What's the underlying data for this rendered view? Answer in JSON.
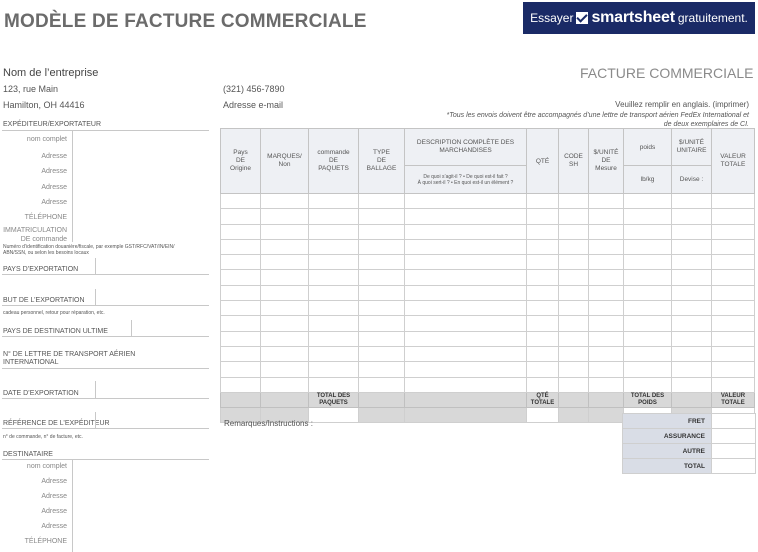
{
  "header": {
    "title": "MODÈLE DE FACTURE COMMERCIALE",
    "banner_try": "Essayer",
    "banner_brand": "smartsheet",
    "banner_free": "gratuitement."
  },
  "company": {
    "name": "Nom de l’entreprise",
    "address": "123, rue Main",
    "city": "Hamilton, OH 44416",
    "phone": "(321) 456-7890",
    "email": "Adresse e-mail"
  },
  "invoice_title": "FACTURE COMMERCIALE",
  "fill_note": "Veuillez remplir en anglais. (imprimer)",
  "notice_line1": "*Tous les envois doivent être accompagnés d’une lettre de transport aérien FedEx International et",
  "notice_line2": "de deux exemplaires de CI.",
  "exporter": {
    "section": "EXPÉDITEUR/EXPORTATEUR",
    "fields": [
      "nom complet",
      "Adresse",
      "Adresse",
      "Adresse",
      "Adresse",
      "TÉLÉPHONE"
    ],
    "reg_line1": "IMMATRICULATION",
    "reg_line2": "DE commande",
    "id_note_line1": "Numéro d’identification douanière/fiscale, par exemple GST/RFC/VAT/IN/EIN/",
    "id_note_line2": "ABN/SSN, ou selon les besoins locaux"
  },
  "fields": {
    "export_country": "PAYS D’EXPORTATION",
    "export_purpose": "BUT DE L’EXPORTATION",
    "export_purpose_note": "cadeau personnel, retour pour réparation, etc.",
    "destination_country": "PAYS DE DESTINATION ULTIME",
    "airway_line1": "N° DE LETTRE DE TRANSPORT AÉRIEN",
    "airway_line2": "INTERNATIONAL",
    "export_date": "DATE D’EXPORTATION",
    "shipper_ref": "RÉFÉRENCE DE L’EXPÉDITEUR",
    "shipper_ref_note": "n° de commande, n° de facture, etc."
  },
  "recipient": {
    "section": "DESTINATAIRE",
    "fields": [
      "nom complet",
      "Adresse",
      "Adresse",
      "Adresse",
      "Adresse",
      "TÉLÉPHONE"
    ]
  },
  "table": {
    "h_origin": "Pays\nDE\nOrigine",
    "h_marks": "MARQUES/\nNon",
    "h_packages": "commande\nDE\nPAQUETS",
    "h_packing": "TYPE\nDE\nBALLAGE",
    "h_desc": "DESCRIPTION COMPLÈTE DES\nMARCHANDISES",
    "h_desc_sub": "De quoi s’agit-il ? • De quoi est-il fait ?\nÀ quoi sert-il ? • En quoi est-il un élément ?",
    "h_qty": "QTÉ",
    "h_hs": "CODE\nSH",
    "h_measure": "$/UNITÉ\nDE\nMesure",
    "h_weight": "poids",
    "h_weight_unit": "lb/kg",
    "h_unit": "$/UNITÉ\nUNITAIRE",
    "h_unit_cur": "Devise :",
    "h_total": "VALEUR\nTOTALE",
    "tot_packages": "TOTAL DES\nPAQUETS",
    "tot_qty": "QTÉ\nTOTALE",
    "tot_weight": "TOTAL DES\nPOIDS",
    "tot_value": "VALEUR\nTOTALE"
  },
  "remarks": "Remarques/Instructions :",
  "summary": [
    "FRET",
    "ASSURANCE",
    "AUTRE",
    "TOTAL"
  ]
}
